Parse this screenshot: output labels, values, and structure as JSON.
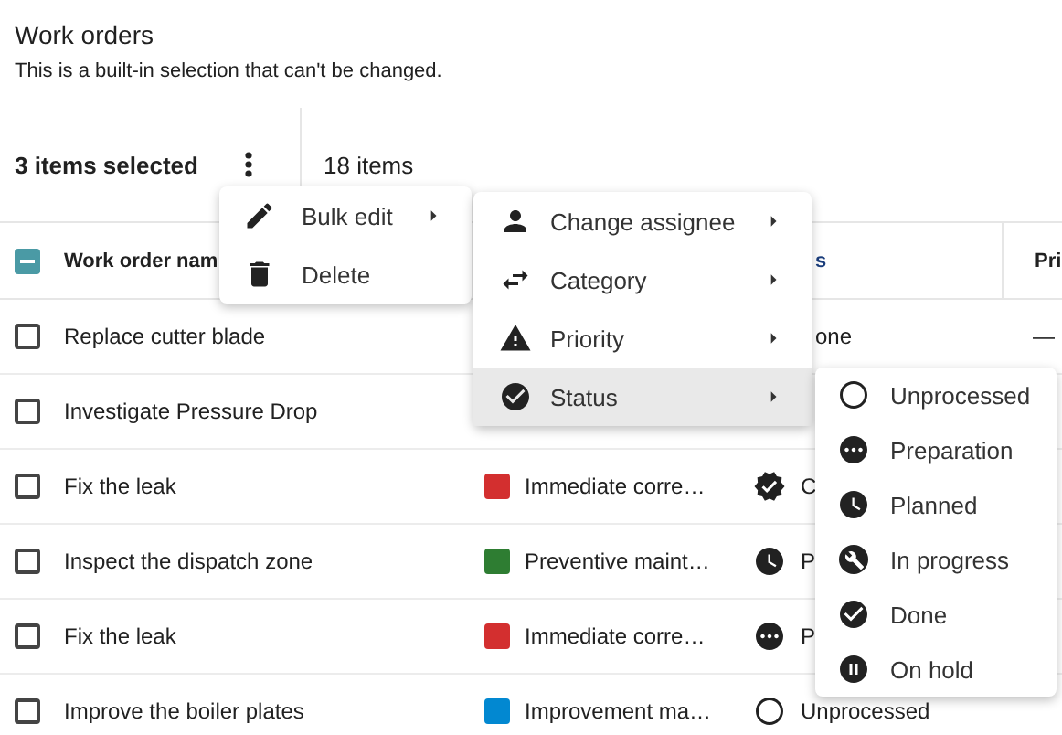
{
  "page": {
    "title": "Work orders",
    "subtitle": "This is a built-in selection that can't be changed."
  },
  "toolbar": {
    "selection": "3 items selected",
    "total": "18 items"
  },
  "table": {
    "header_checkbox": {
      "indeterminate": true
    },
    "columns": [
      {
        "label": "Work order nam"
      },
      {
        "label": "s"
      },
      {
        "label": "Pri"
      }
    ],
    "rows": [
      {
        "name": "Replace cutter blade",
        "checked": false,
        "status": {
          "kind": "none",
          "label": "one"
        },
        "priority": "—"
      },
      {
        "name": "Investigate Pressure Drop",
        "checked": false
      },
      {
        "name": "Fix the leak",
        "checked": false,
        "category": {
          "label": "Immediate corre…",
          "color": "#d32f2f"
        },
        "status": {
          "kind": "verified",
          "label": "C"
        }
      },
      {
        "name": "Inspect the dispatch zone",
        "checked": false,
        "category": {
          "label": "Preventive maint…",
          "color": "#2e7d32"
        },
        "status": {
          "kind": "planned",
          "label": "P"
        }
      },
      {
        "name": "Fix the leak",
        "checked": false,
        "category": {
          "label": "Immediate corre…",
          "color": "#d32f2f"
        },
        "status": {
          "kind": "preparation",
          "label": "P"
        }
      },
      {
        "name": "Improve the boiler plates",
        "checked": false,
        "category": {
          "label": "Improvement ma…",
          "color": "#0288d1"
        },
        "status": {
          "kind": "unprocessed",
          "label": "Unprocessed"
        }
      }
    ]
  },
  "menus": [
    {
      "items": [
        {
          "kind": "pencil",
          "label": "Bulk edit",
          "has_submenu": true,
          "highlighted": false
        },
        {
          "kind": "trash",
          "label": "Delete",
          "has_submenu": false,
          "highlighted": false
        }
      ]
    },
    {
      "items": [
        {
          "kind": "person",
          "label": "Change assignee",
          "has_submenu": true,
          "highlighted": false
        },
        {
          "kind": "swap",
          "label": "Category",
          "has_submenu": true,
          "highlighted": false
        },
        {
          "kind": "warning",
          "label": "Priority",
          "has_submenu": true,
          "highlighted": false
        },
        {
          "kind": "done",
          "label": "Status",
          "has_submenu": true,
          "highlighted": true
        }
      ]
    },
    {
      "items": [
        {
          "kind": "unprocessed",
          "label": "Unprocessed",
          "has_submenu": false,
          "highlighted": false
        },
        {
          "kind": "preparation",
          "label": "Preparation",
          "has_submenu": false,
          "highlighted": false
        },
        {
          "kind": "planned",
          "label": "Planned",
          "has_submenu": false,
          "highlighted": false
        },
        {
          "kind": "in_progress",
          "label": "In progress",
          "has_submenu": false,
          "highlighted": false
        },
        {
          "kind": "done",
          "label": "Done",
          "has_submenu": false,
          "highlighted": false
        },
        {
          "kind": "on_hold",
          "label": "On hold",
          "has_submenu": false,
          "highlighted": false
        }
      ]
    }
  ]
}
